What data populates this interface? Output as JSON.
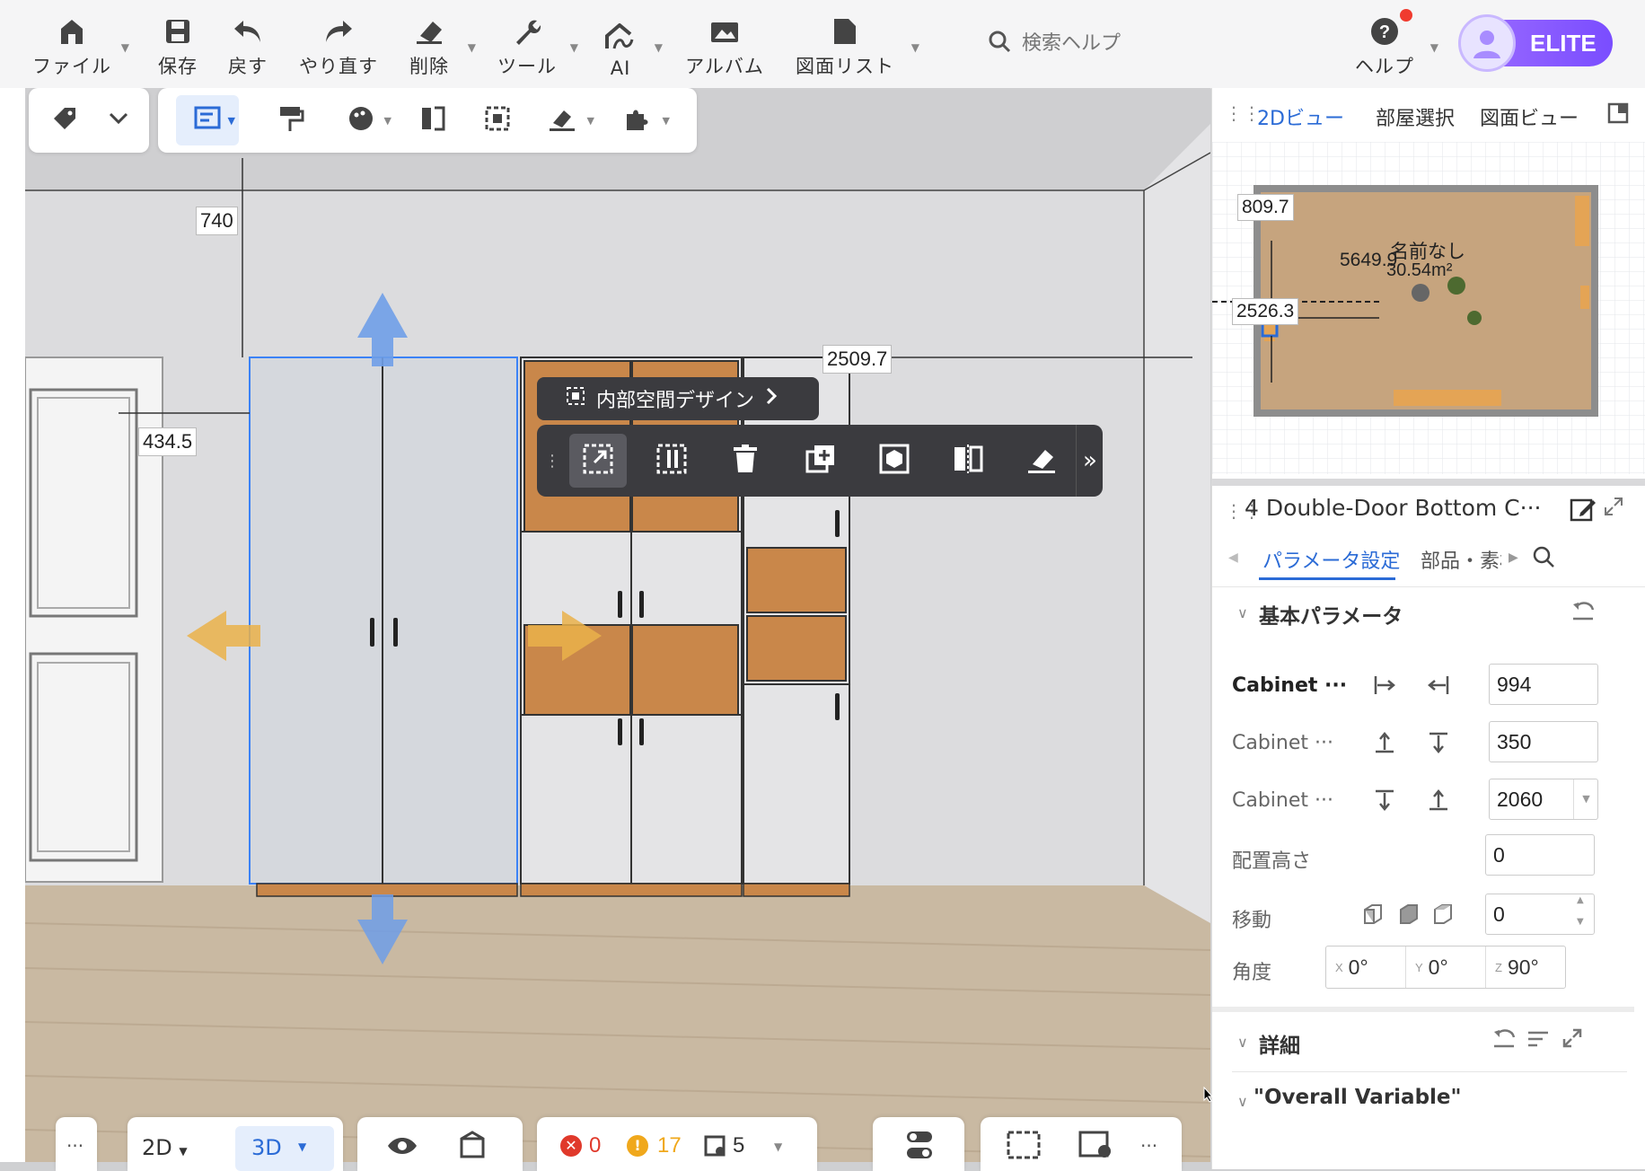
{
  "menu": {
    "items": [
      {
        "label": "ファイル",
        "icon": "house-icon"
      },
      {
        "label": "保存",
        "icon": "save-icon"
      },
      {
        "label": "戻す",
        "icon": "undo-icon"
      },
      {
        "label": "やり直す",
        "icon": "redo-icon"
      },
      {
        "label": "削除",
        "icon": "eraser-icon"
      },
      {
        "label": "ツール",
        "icon": "wrench-icon"
      },
      {
        "label": "AI",
        "icon": "ai-icon"
      },
      {
        "label": "アルバム",
        "icon": "album-icon"
      },
      {
        "label": "図面リスト",
        "icon": "document-icon"
      }
    ],
    "search_placeholder": "検索ヘルプ",
    "help_label": "ヘルプ",
    "elite_label": "ELITE"
  },
  "viewport": {
    "dimensions": {
      "top": "740",
      "left": "434.5",
      "right": "2509.7"
    },
    "interior_design_label": "内部空間デザイン"
  },
  "minimap": {
    "tabs": [
      "2Dビュー",
      "部屋選択",
      "図面ビュー"
    ],
    "active_tab": 0,
    "labels": {
      "top": "809.7",
      "mid": "5649.9",
      "bottom": "2526.3",
      "room_name": "名前なし",
      "room_area": "30.54m²"
    }
  },
  "props": {
    "title": "4 Double-Door Bottom C···",
    "tabs": [
      "パラメータ設定",
      "部品・素材"
    ],
    "active_tab": 0,
    "section_basic": "基本パラメータ",
    "params": [
      {
        "label": "Cabinet ···",
        "value": "994",
        "bold": true
      },
      {
        "label": "Cabinet ···",
        "value": "350"
      },
      {
        "label": "Cabinet ···",
        "value": "2060"
      },
      {
        "label": "配置高さ",
        "value": "0"
      },
      {
        "label": "移動",
        "value": "0"
      }
    ],
    "angle": {
      "label": "角度",
      "x": "0°",
      "y": "0°",
      "z": "90°",
      "x_prefix": "X",
      "y_prefix": "Y",
      "z_prefix": "Z"
    },
    "section_detail": "詳細",
    "section_overall": "\"Overall Variable\""
  },
  "bottom": {
    "more": "···",
    "view_2d": "2D",
    "view_3d": "3D",
    "errors": "0",
    "warnings": "17",
    "items": "5"
  },
  "colors": {
    "accent": "#2b6bd6",
    "elite": "#8a5cff",
    "error": "#e0392b",
    "warning": "#f0a81c",
    "wood": "#c9874a"
  }
}
